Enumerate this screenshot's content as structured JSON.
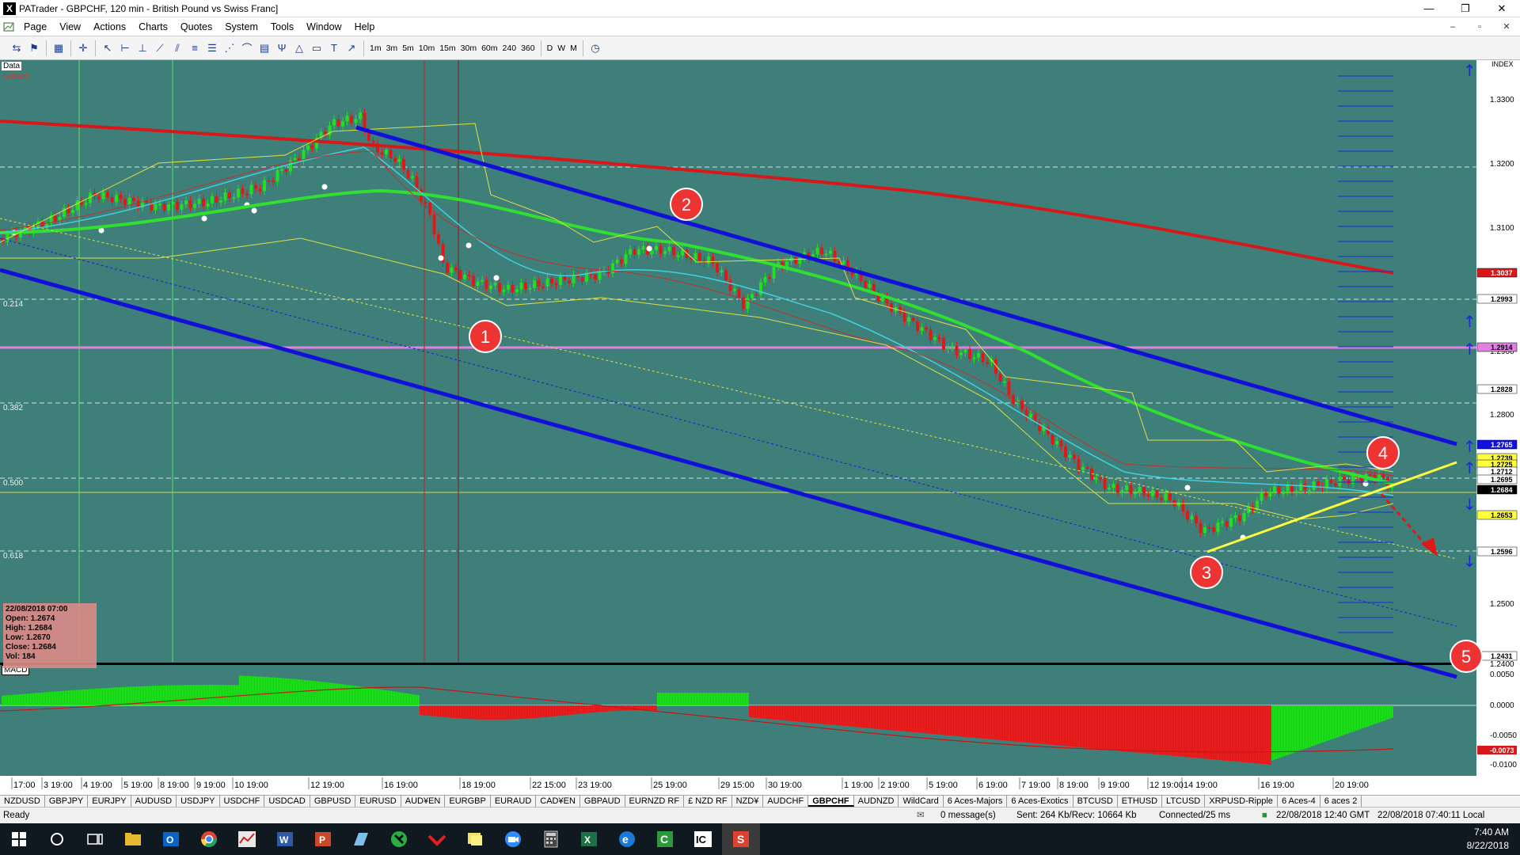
{
  "window": {
    "title": "PATrader - GBPCHF, 120 min - British Pound vs Swiss Franc]",
    "app_letter": "X",
    "controls": [
      "—",
      "❐",
      "✕"
    ],
    "mdi_controls": [
      "–",
      "▫",
      "✕"
    ]
  },
  "menu": [
    "Page",
    "View",
    "Actions",
    "Charts",
    "Quotes",
    "System",
    "Tools",
    "Window",
    "Help"
  ],
  "toolbar": {
    "timeframes": [
      "1m",
      "3m",
      "5m",
      "10m",
      "15m",
      "30m",
      "60m",
      "240",
      "360",
      "D",
      "W",
      "M"
    ]
  },
  "chart": {
    "labels": {
      "data": "Data",
      "locked": "Locked",
      "index": "INDEX",
      "macd": "MACD"
    },
    "price_axis": [
      "1.3300",
      "1.3200",
      "1.3100",
      "1.2900",
      "1.2800",
      "1.2500",
      "1.2400"
    ],
    "price_tags": [
      {
        "text": "1.3037",
        "bg": "#d81818",
        "fg": "#ffffff"
      },
      {
        "text": "1.2993",
        "bg": "#ffffff",
        "fg": "#000000"
      },
      {
        "text": "1.2914",
        "bg": "#e080e0",
        "fg": "#000000"
      },
      {
        "text": "1.2828",
        "bg": "#ffffff",
        "fg": "#000000"
      },
      {
        "text": "1.2765",
        "bg": "#1010e0",
        "fg": "#ffffff"
      },
      {
        "text": "1.2739",
        "bg": "#ffff40",
        "fg": "#000000"
      },
      {
        "text": "1.2725",
        "bg": "#ffff40",
        "fg": "#000000"
      },
      {
        "text": "1.2712",
        "bg": "#ffffff",
        "fg": "#000000"
      },
      {
        "text": "1.2695",
        "bg": "#ffffff",
        "fg": "#000000"
      },
      {
        "text": "1.2684",
        "bg": "#000000",
        "fg": "#ffffff"
      },
      {
        "text": "1.2653",
        "bg": "#ffff40",
        "fg": "#000000"
      },
      {
        "text": "1.2596",
        "bg": "#ffffff",
        "fg": "#000000"
      },
      {
        "text": "1.2431",
        "bg": "#ffffff",
        "fg": "#000000"
      }
    ],
    "macd_axis": [
      "0.0050",
      "0.0000",
      "-0.0050",
      "-0.0100"
    ],
    "macd_tag": {
      "text": "-0.0073",
      "bg": "#d81818",
      "fg": "#ffffff"
    },
    "fib_levels": [
      "0.214",
      "0.382",
      "0.500",
      "0.618"
    ],
    "time_axis": [
      "17:00",
      "3 19:00",
      "4 19:00",
      "5 19:00",
      "8 19:00",
      "9 19:00",
      "10 19:00",
      "12 19:00",
      "16 19:00",
      "18 19:00",
      "22 15:00",
      "23 19:00",
      "25 19:00",
      "29 15:00",
      "30 19:00",
      "1 19:00",
      "2 19:00",
      "5 19:00",
      "6 19:00",
      "7 19:00",
      "8 19:00",
      "9 19:00",
      "12 19:00",
      "14 19:00",
      "16 19:00",
      "20 19:00"
    ],
    "annotations": [
      "1",
      "2",
      "3",
      "4",
      "5"
    ],
    "ohlc": {
      "date": "22/08/2018 07:00",
      "open": "Open: 1.2674",
      "high": "High: 1.2684",
      "low": "Low: 1.2670",
      "close": "Close: 1.2684",
      "vol": "Vol: 184"
    },
    "colors": {
      "bg": "#3f7f7a",
      "bull": "#20e020",
      "bear": "#e01818",
      "channel": "#1010d8",
      "ma_long": "#d81818",
      "ma_mid": "#30e030",
      "cyan": "#40d0e0",
      "band": "#e0e040",
      "magenta": "#e080e0"
    }
  },
  "symbol_tabs": [
    "NZDUSD",
    "GBPJPY",
    "EURJPY",
    "AUDUSD",
    "USDJPY",
    "USDCHF",
    "USDCAD",
    "GBPUSD",
    "EURUSD",
    "AUD¥EN",
    "EURGBP",
    "EURAUD",
    "CAD¥EN",
    "GBPAUD",
    "EURNZD RF",
    "£ NZD RF",
    "NZD¥",
    "AUDCHF",
    "GBPCHF",
    "AUDNZD",
    "WildCard",
    "6 Aces-Majors",
    "6 Aces-Exotics",
    "BTCUSD",
    "ETHUSD",
    "LTCUSD",
    "XRPUSD-Ripple",
    "6 Aces-4",
    "6 aces 2"
  ],
  "active_tab": "GBPCHF",
  "status": {
    "ready": "Ready",
    "messages": "0 message(s)",
    "sent": "Sent: 264 Kb/Recv: 10664 Kb",
    "connected": "Connected/25 ms",
    "gmt": "22/08/2018 12:40 GMT",
    "local": "22/08/2018 07:40:11 Local"
  },
  "taskbar": {
    "time": "7:40 AM",
    "date": "8/22/2018"
  }
}
